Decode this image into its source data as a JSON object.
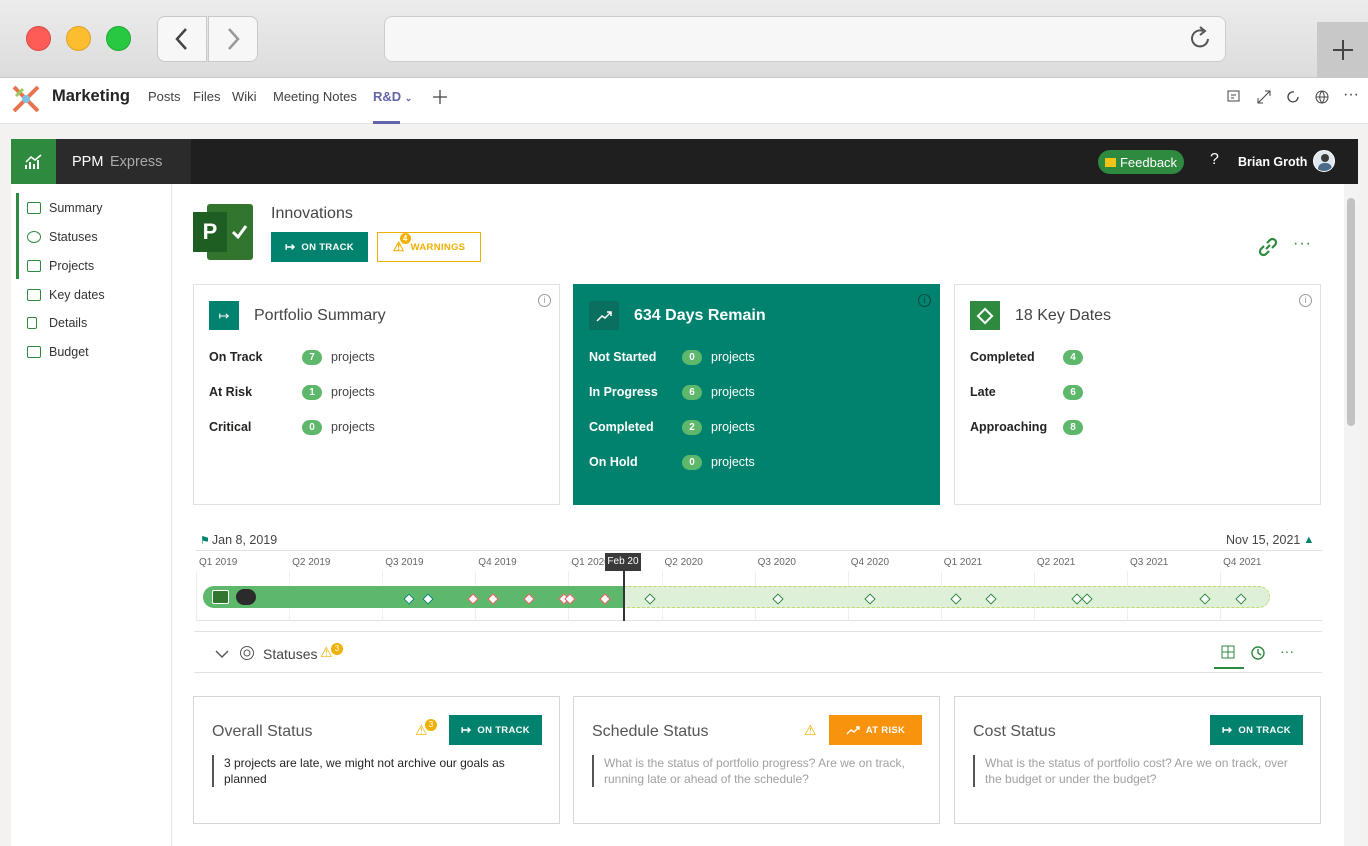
{
  "teams": {
    "app_name": "Marketing",
    "tabs": [
      "Posts",
      "Files",
      "Wiki",
      "Meeting Notes",
      "R&D"
    ]
  },
  "ppm": {
    "brand": "PPM",
    "brand_sub": "Express",
    "feedback": "Feedback",
    "help": "?",
    "user": "Brian Groth"
  },
  "sidebar": {
    "items": [
      "Summary",
      "Statuses",
      "Projects",
      "Key dates",
      "Details",
      "Budget"
    ]
  },
  "header": {
    "title": "Innovations",
    "on_track": "ON TRACK",
    "warnings": "WARNINGS",
    "warnings_count": "4"
  },
  "portfolio": {
    "title": "Portfolio Summary",
    "rows": [
      {
        "label": "On Track",
        "count": "7",
        "unit": "projects"
      },
      {
        "label": "At Risk",
        "count": "1",
        "unit": "projects"
      },
      {
        "label": "Critical",
        "count": "0",
        "unit": "projects"
      }
    ]
  },
  "days": {
    "title": "634 Days Remain",
    "rows": [
      {
        "label": "Not Started",
        "count": "0",
        "unit": "projects"
      },
      {
        "label": "In Progress",
        "count": "6",
        "unit": "projects"
      },
      {
        "label": "Completed",
        "count": "2",
        "unit": "projects"
      },
      {
        "label": "On Hold",
        "count": "0",
        "unit": "projects"
      }
    ]
  },
  "keydates": {
    "title": "18 Key Dates",
    "rows": [
      {
        "label": "Completed",
        "count": "4"
      },
      {
        "label": "Late",
        "count": "6"
      },
      {
        "label": "Approaching",
        "count": "8"
      }
    ]
  },
  "timeline": {
    "start": "Jan 8, 2019",
    "end": "Nov 15, 2021",
    "today": "Feb 20",
    "quarters": [
      "Q1 2019",
      "Q2 2019",
      "Q3 2019",
      "Q4 2019",
      "Q1 2020",
      "Q2 2020",
      "Q3 2020",
      "Q4 2020",
      "Q1 2021",
      "Q2 2021",
      "Q3 2021",
      "Q4 2021"
    ],
    "today_fraction": 0.396
  },
  "statuses": {
    "label": "Statuses",
    "badge": "3",
    "cards": [
      {
        "title": "Overall Status",
        "badge": "ON TRACK",
        "text": "3 projects are late, we might not archive our goals as planned",
        "warn_count": "3"
      },
      {
        "title": "Schedule Status",
        "badge": "AT RISK",
        "text": "What is the status of portfolio progress? Are we on track, running late or ahead of the schedule?"
      },
      {
        "title": "Cost Status",
        "badge": "ON TRACK",
        "text": "What is the status of portfolio cost? Are we on track, over the budget or under the budget?"
      }
    ]
  },
  "colors": {
    "teal": "#00826e",
    "green": "#2d8a3e",
    "pill": "#5db86b",
    "orange": "#f7930c",
    "warn": "#f0b000"
  }
}
